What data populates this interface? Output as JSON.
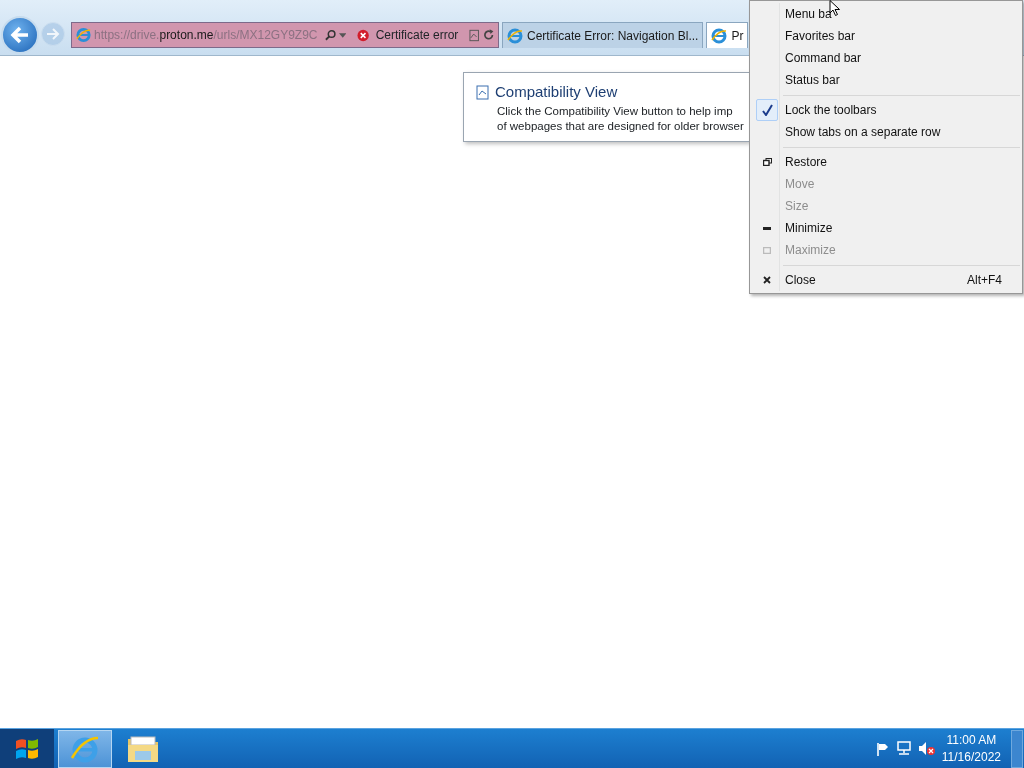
{
  "browser": {
    "back_button": {
      "disabled": false
    },
    "forward_button": {
      "disabled": true
    },
    "address_bar": {
      "url_prefix": "https://drive.",
      "url_domain": "proton.me",
      "url_suffix": "/urls/MX12GY9Z9C",
      "certificate_status": "Certificate error"
    },
    "tabs": [
      {
        "label": "Certificate Error: Navigation Bl...",
        "selected": false
      },
      {
        "label": "Pr",
        "selected": true
      }
    ],
    "callout": {
      "title": "Compatibility View",
      "lines": [
        "Click the Compatibility View button to help imp",
        "of webpages that are designed for older browser"
      ]
    }
  },
  "context_menu": {
    "items": [
      {
        "kind": "item",
        "label": "Menu ba",
        "checked": false,
        "disabled": false
      },
      {
        "kind": "item",
        "label": "Favorites bar",
        "checked": false,
        "disabled": false
      },
      {
        "kind": "item",
        "label": "Command bar",
        "checked": false,
        "disabled": false
      },
      {
        "kind": "item",
        "label": "Status bar",
        "checked": false,
        "disabled": false
      },
      {
        "kind": "separator"
      },
      {
        "kind": "item",
        "label": "Lock the toolbars",
        "checked": true,
        "disabled": false
      },
      {
        "kind": "item",
        "label": "Show tabs on a separate row",
        "checked": false,
        "disabled": false
      },
      {
        "kind": "separator"
      },
      {
        "kind": "restore",
        "label": "Restore",
        "checked": false,
        "disabled": false
      },
      {
        "kind": "item",
        "label": "Move",
        "checked": false,
        "disabled": true
      },
      {
        "kind": "item",
        "label": "Size",
        "checked": false,
        "disabled": true
      },
      {
        "kind": "minimize",
        "label": "Minimize",
        "checked": false,
        "disabled": false
      },
      {
        "kind": "maximize",
        "label": "Maximize",
        "checked": false,
        "disabled": true
      },
      {
        "kind": "separator"
      },
      {
        "kind": "close",
        "label": "Close",
        "shortcut": "Alt+F4",
        "checked": false,
        "disabled": false
      }
    ]
  },
  "taskbar": {
    "apps": [
      {
        "kind": "browser",
        "selected": true
      },
      {
        "kind": "folder",
        "selected": false
      }
    ],
    "clock": {
      "time": "11:00 AM",
      "date": "11/16/2022"
    }
  }
}
